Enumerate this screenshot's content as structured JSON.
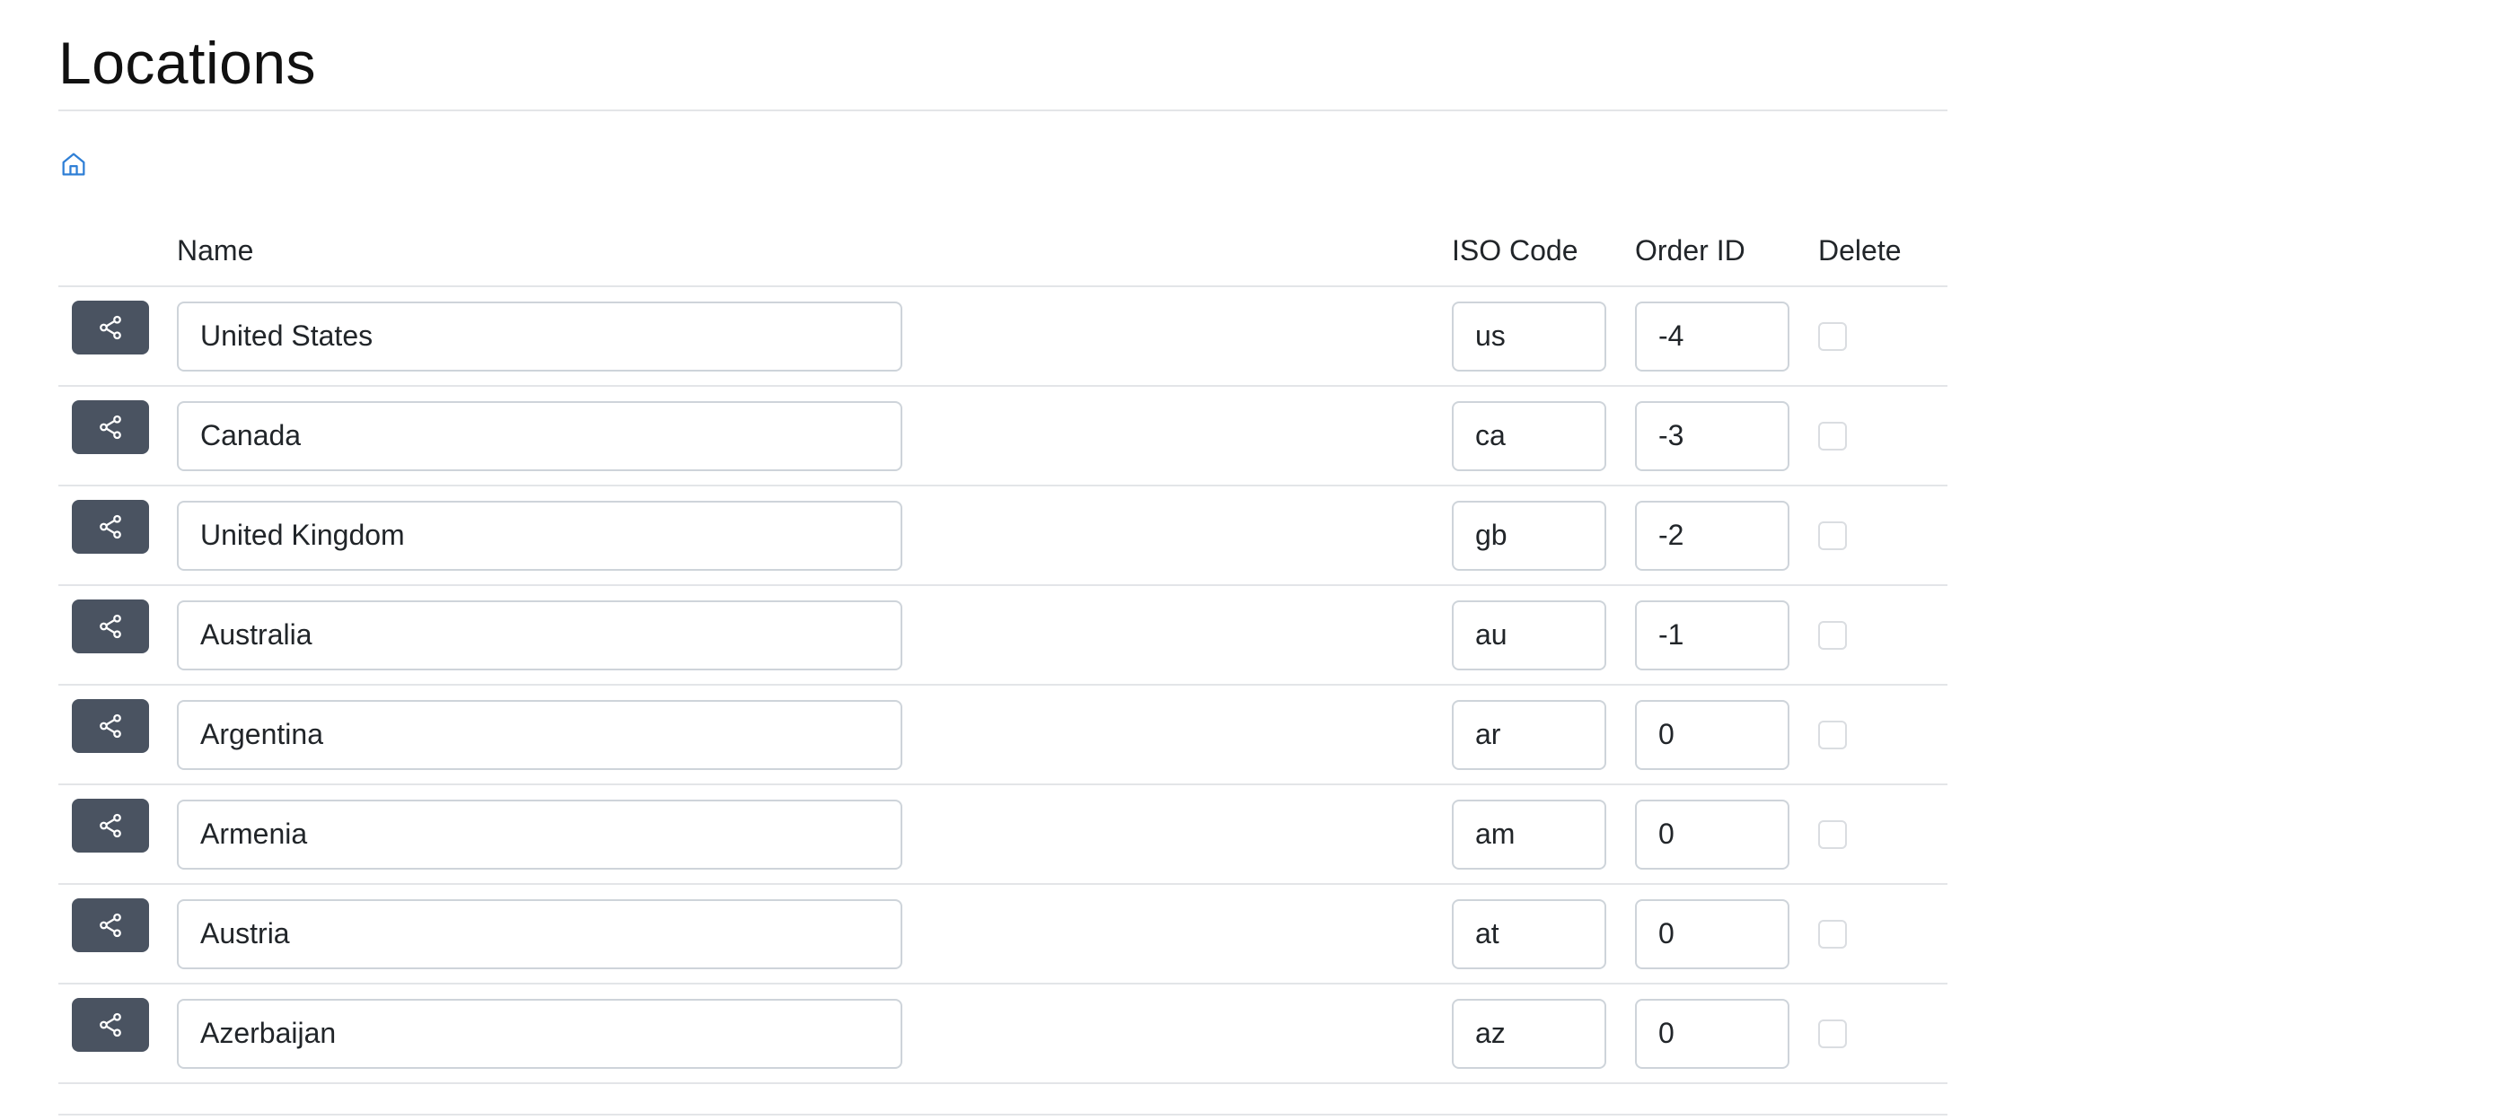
{
  "page": {
    "title": "Locations"
  },
  "breadcrumb": {
    "home_icon": "home-icon",
    "accent_color": "#2f7fd6"
  },
  "table": {
    "columns": {
      "share": "",
      "name": "Name",
      "iso": "ISO Code",
      "order": "Order ID",
      "delete": "Delete"
    },
    "rows": [
      {
        "name": "United States",
        "iso": "us",
        "order": "-4"
      },
      {
        "name": "Canada",
        "iso": "ca",
        "order": "-3"
      },
      {
        "name": "United Kingdom",
        "iso": "gb",
        "order": "-2"
      },
      {
        "name": "Australia",
        "iso": "au",
        "order": "-1"
      },
      {
        "name": "Argentina",
        "iso": "ar",
        "order": "0"
      },
      {
        "name": "Armenia",
        "iso": "am",
        "order": "0"
      },
      {
        "name": "Austria",
        "iso": "at",
        "order": "0"
      },
      {
        "name": "Azerbaijan",
        "iso": "az",
        "order": "0"
      }
    ]
  },
  "share_button": {
    "icon": "share-icon",
    "color": "#4a5361"
  }
}
